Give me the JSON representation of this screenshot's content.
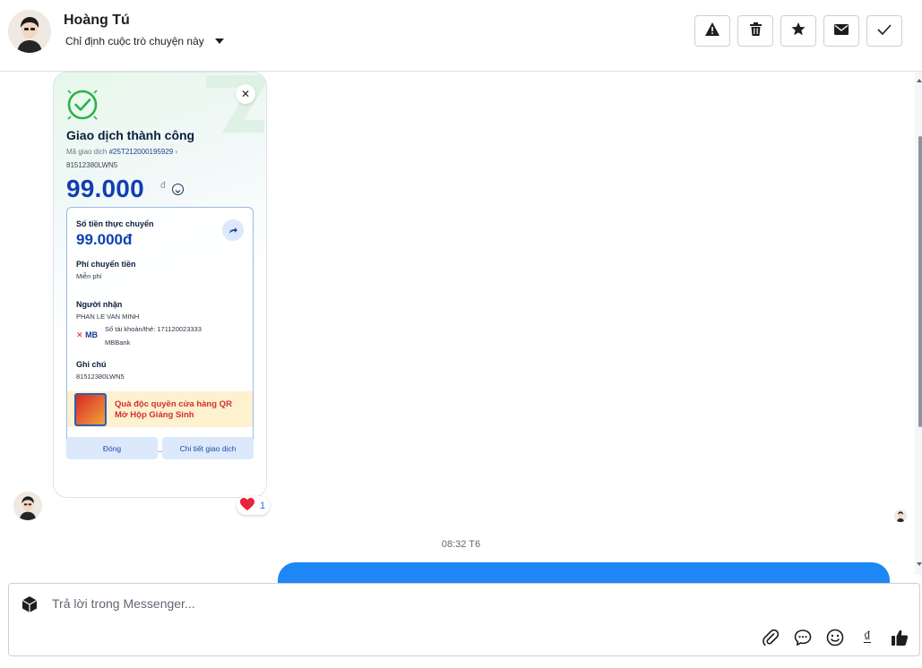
{
  "header": {
    "contact_name": "Hoàng Tú",
    "assign_label": "Chỉ định cuộc trò chuyện này",
    "tools": [
      "spam-icon",
      "trash-icon",
      "star-icon",
      "envelope-icon",
      "check-icon"
    ]
  },
  "receipt": {
    "title": "Giao dịch thành công",
    "code_label": "Mã giao dịch",
    "code_value": "#25T212000195929",
    "reference": "81512380LWN5",
    "amount": "99.000",
    "amount_unit": "đ",
    "actual_label": "Số tiền thực chuyển",
    "actual_value": "99.000đ",
    "fee_label": "Phí chuyển tiền",
    "fee_value": "Miễn phí",
    "recipient_label": "Người nhận",
    "recipient_name": "PHAN LE VAN MINH",
    "account_label": "Số tài khoản/thẻ:",
    "account_number": "171120023333",
    "bank_logo_prefix": "✕",
    "bank_logo_text": "MB",
    "bank_name": "MBBank",
    "note_label": "Ghi chú",
    "note_value": "81512380LWN5",
    "promo_line1": "Quà độc quyền cửa hàng QR",
    "promo_line2": "Mở Hộp Giáng Sinh",
    "close_button": "Đóng",
    "detail_button": "Chi tiết giao dịch"
  },
  "reaction": {
    "emoji": "❤️",
    "count": "1"
  },
  "timestamp": "08:32 T6",
  "composer": {
    "placeholder": "Trả lời trong Messenger...",
    "tools": [
      "attachment-icon",
      "saved-reply-icon",
      "emoji-icon",
      "dong-icon",
      "thumbs-up-icon"
    ],
    "dong_symbol": "₫"
  },
  "colors": {
    "accent": "#1d87f5",
    "amount": "#0f3fb3",
    "success": "#2bb24c"
  }
}
